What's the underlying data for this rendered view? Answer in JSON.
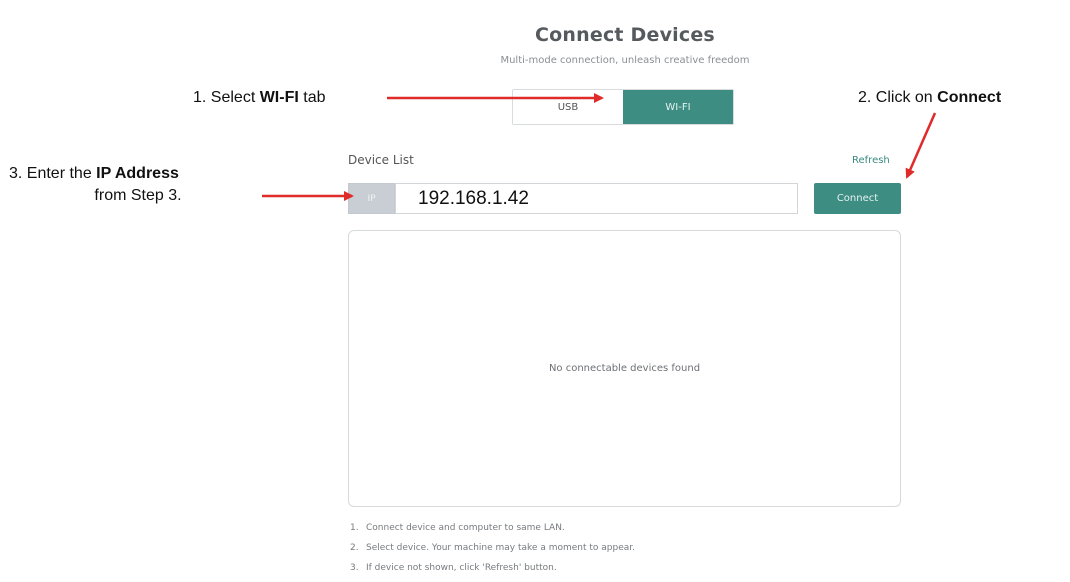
{
  "header": {
    "title": "Connect Devices",
    "subtitle": "Multi-mode connection, unleash creative freedom"
  },
  "tabs": [
    {
      "label": "USB",
      "active": false
    },
    {
      "label": "WI-FI",
      "active": true
    }
  ],
  "device_list": {
    "label": "Device List",
    "refresh_label": "Refresh",
    "ip_prefix": "IP",
    "ip_value": "192.168.1.42",
    "connect_label": "Connect",
    "empty_message": "No connectable devices found"
  },
  "instructions": [
    {
      "num": "1.",
      "text": "Connect device and computer to same LAN."
    },
    {
      "num": "2.",
      "text": "Select device. Your machine may take a moment to appear."
    },
    {
      "num": "3.",
      "text": "If device not shown, click 'Refresh' button."
    }
  ],
  "annotations": {
    "step1_prefix": "1. Select ",
    "step1_bold": "WI-FI",
    "step1_suffix": " tab",
    "step2_prefix": "2. Click on ",
    "step2_bold": "Connect",
    "step3_prefix": "3. Enter the ",
    "step3_bold": "IP Address",
    "step3_line2": "from Step 3."
  },
  "colors": {
    "accent": "#3d8d83",
    "annotation_arrow": "#e02b2b"
  }
}
